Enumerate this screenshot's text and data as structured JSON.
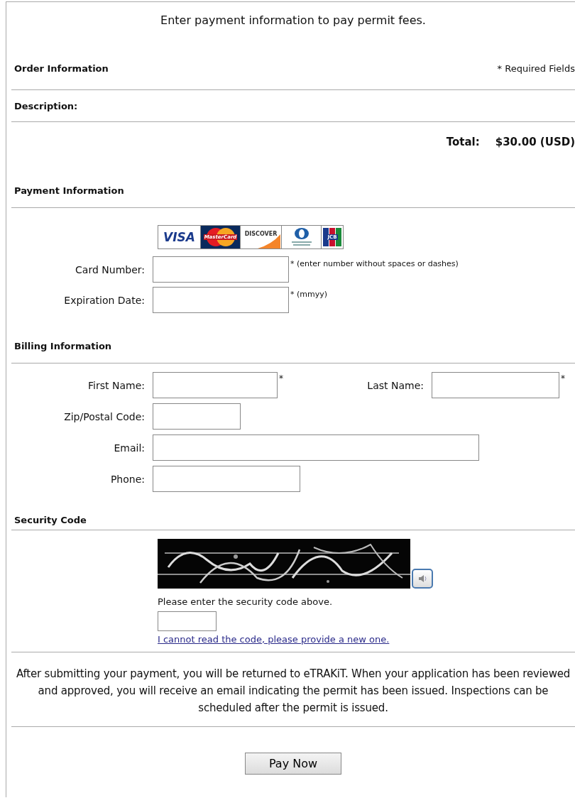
{
  "title": "Enter payment information to pay permit fees.",
  "order": {
    "heading": "Order Information",
    "required_note": "* Required Fields",
    "description_label": "Description:",
    "total_label": "Total:",
    "total_value": "$30.00 (USD)"
  },
  "payment": {
    "heading": "Payment Information",
    "cards": [
      {
        "kind": "visa",
        "label": "VISA"
      },
      {
        "kind": "mastercard",
        "label": "MasterCard"
      },
      {
        "kind": "discover",
        "label": "DISCOVER"
      },
      {
        "kind": "diners"
      },
      {
        "kind": "jcb",
        "label": "JCB"
      }
    ],
    "fields": [
      {
        "label": "Card Number:",
        "note": "* (enter number without spaces or dashes)"
      },
      {
        "label": "Expiration Date:",
        "note": "* (mmyy)"
      }
    ]
  },
  "billing": {
    "heading": "Billing Information",
    "first_name": {
      "label": "First Name:",
      "note": "*"
    },
    "last_name": {
      "label": "Last Name:",
      "note": "*"
    },
    "fields": [
      {
        "label": "Zip/Postal Code:"
      },
      {
        "label": "Email:"
      },
      {
        "label": "Phone:"
      }
    ]
  },
  "security": {
    "heading": "Security Code",
    "prompt": "Please enter the security code above.",
    "new_code_link": "I cannot read the code, please provide a new one."
  },
  "notice": "After submitting your payment, you will be returned to eTRAKiT. When your application has been reviewed and approved, you will receive an email indicating the permit has been issued. Inspections can be scheduled after the permit is issued.",
  "submit_button": "Pay Now"
}
